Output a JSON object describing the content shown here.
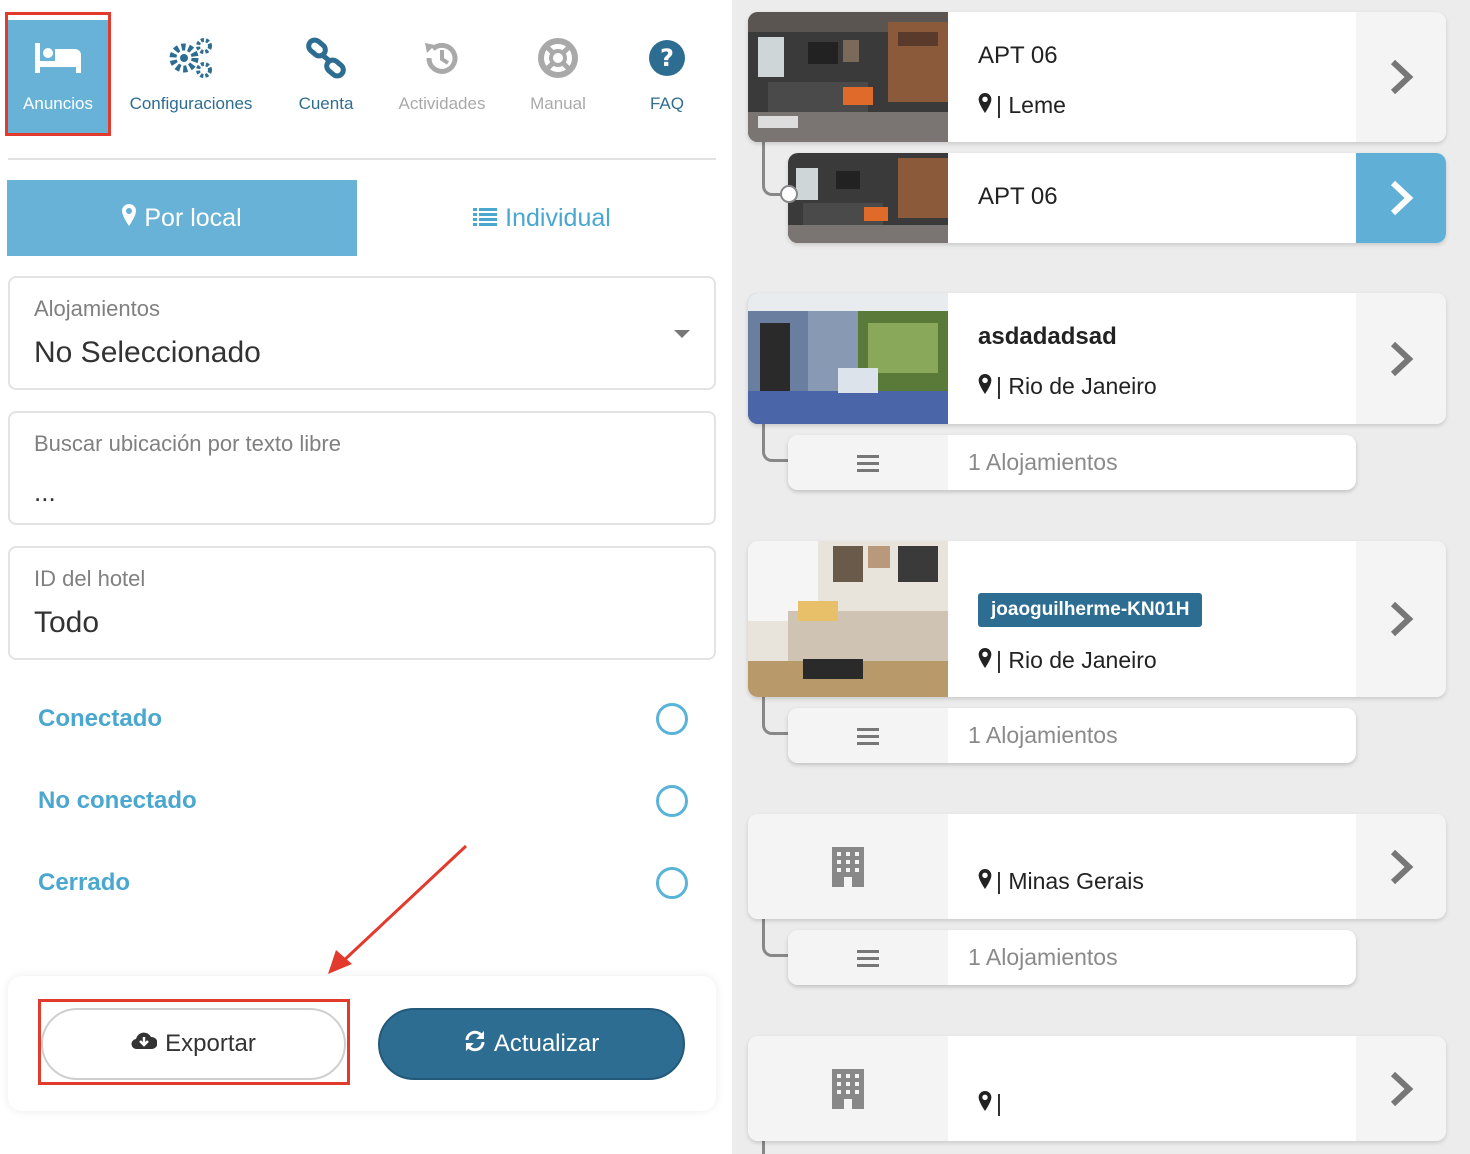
{
  "nav": {
    "items": [
      {
        "label": "Anuncios",
        "icon": "bed-icon"
      },
      {
        "label": "Configuraciones",
        "icon": "gears-icon"
      },
      {
        "label": "Cuenta",
        "icon": "link-icon"
      },
      {
        "label": "Actividades",
        "icon": "history-icon"
      },
      {
        "label": "Manual",
        "icon": "lifebuoy-icon"
      },
      {
        "label": "FAQ",
        "icon": "question-icon"
      }
    ]
  },
  "segments": {
    "by_location": "Por local",
    "individual": "Individual"
  },
  "fields": {
    "accommodations": {
      "label": "Alojamientos",
      "value": "No Seleccionado"
    },
    "search": {
      "label": "Buscar ubicación por texto libre",
      "value": "..."
    },
    "hotel_id": {
      "label": "ID del hotel",
      "value": "Todo"
    }
  },
  "filters": [
    {
      "label": "Conectado"
    },
    {
      "label": "No conectado"
    },
    {
      "label": "Cerrado"
    }
  ],
  "buttons": {
    "export": "Exportar",
    "update": "Actualizar"
  },
  "listings": [
    {
      "title": "APT 06",
      "location": "| Leme",
      "child": {
        "title": "APT 06"
      }
    },
    {
      "title": "asdadadsad",
      "location": "| Rio de Janeiro",
      "sub": "1 Alojamientos"
    },
    {
      "badge": "joaoguilherme-KN01H",
      "location": "| Rio de Janeiro",
      "sub": "1 Alojamientos"
    },
    {
      "location": "| Minas Gerais",
      "sub": "1 Alojamientos"
    },
    {
      "location": "|"
    }
  ],
  "colors": {
    "accent": "#67b2d6",
    "primary": "#2e6d92",
    "highlight": "#e23a2c",
    "link": "#4aa7cf"
  }
}
